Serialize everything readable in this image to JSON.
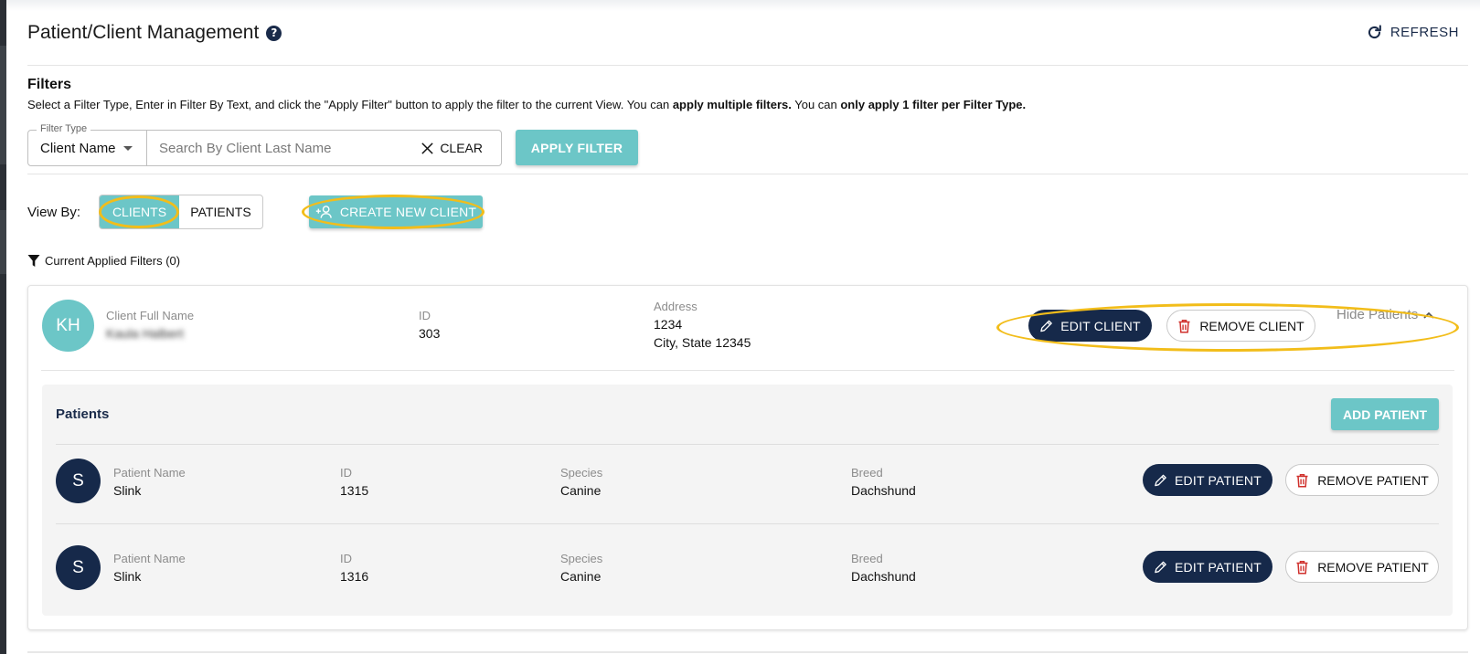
{
  "header": {
    "title": "Patient/Client Management",
    "refresh_label": "REFRESH"
  },
  "filters": {
    "title": "Filters",
    "desc_part1": "Select a Filter Type, Enter in Filter By Text, and click the \"Apply Filter\" button to apply the filter to the current View. You can ",
    "desc_bold1": "apply multiple filters.",
    "desc_part2": " You can ",
    "desc_bold2": "only apply 1 filter per Filter Type.",
    "type_label": "Filter Type",
    "type_value": "Client Name",
    "search_placeholder": "Search By Client Last Name",
    "search_value": "",
    "clear_label": "CLEAR",
    "apply_label": "APPLY FILTER"
  },
  "view": {
    "label": "View By:",
    "options": [
      "CLIENTS",
      "PATIENTS"
    ],
    "selected": "CLIENTS",
    "create_label": "CREATE NEW CLIENT",
    "applied_filters": "Current Applied Filters (0)"
  },
  "client": {
    "initials": "KH",
    "name_label": "Client Full Name",
    "name_value": "Kaula Halbert",
    "id_label": "ID",
    "id_value": "303",
    "address_label": "Address",
    "address_line1": "1234",
    "address_line2": "City, State 12345",
    "edit_label": "EDIT CLIENT",
    "remove_label": "REMOVE CLIENT",
    "toggle_patients_label": "Hide Patients"
  },
  "patients": {
    "title": "Patients",
    "add_label": "ADD PATIENT",
    "rows": [
      {
        "initial": "S",
        "name_label": "Patient Name",
        "name_value": "Slink",
        "id_label": "ID",
        "id_value": "1315",
        "species_label": "Species",
        "species_value": "Canine",
        "breed_label": "Breed",
        "breed_value": "Dachshund",
        "edit_label": "EDIT PATIENT",
        "remove_label": "REMOVE PATIENT"
      },
      {
        "initial": "S",
        "name_label": "Patient Name",
        "name_value": "Slink",
        "id_label": "ID",
        "id_value": "1316",
        "species_label": "Species",
        "species_value": "Canine",
        "breed_label": "Breed",
        "breed_value": "Dachshund",
        "edit_label": "EDIT PATIENT",
        "remove_label": "REMOVE PATIENT"
      }
    ]
  },
  "colors": {
    "accent_teal": "#6cc6c7",
    "navy": "#16294a",
    "highlight": "#f2bd1a",
    "delete_red": "#d0312d"
  },
  "icons": [
    "help-icon",
    "refresh-icon",
    "close-icon",
    "caret-down-icon",
    "add-user-icon",
    "filter-icon",
    "pencil-icon",
    "trash-icon",
    "chevron-up-icon"
  ]
}
